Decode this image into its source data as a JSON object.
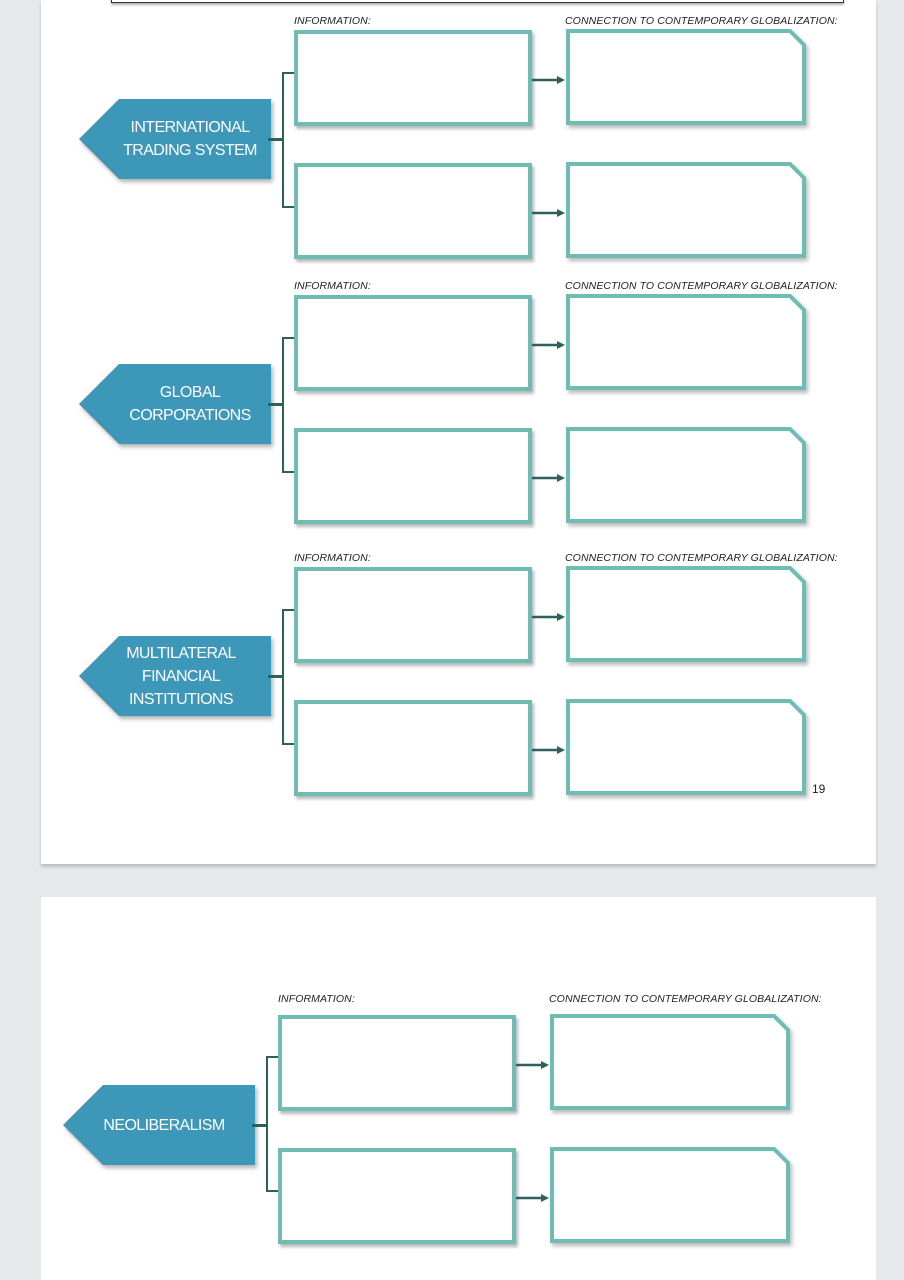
{
  "document": {
    "page_number": "19",
    "accent_colors": {
      "tag_fill": "#3d97b8",
      "box_border": "#6fbcb5",
      "connector": "#2f5f5c",
      "page_background": "#ffffff",
      "viewer_background": "#e6e8ec"
    },
    "column_labels": {
      "information": "INFORMATION:",
      "connection": "CONNECTION TO CONTEMPORARY GLOBALIZATION:"
    },
    "sections": [
      {
        "topic_lines": [
          "INTERNATIONAL",
          "TRADING SYSTEM"
        ],
        "information_boxes": [
          "",
          ""
        ],
        "connection_boxes": [
          "",
          ""
        ]
      },
      {
        "topic_lines": [
          "GLOBAL",
          "CORPORATIONS"
        ],
        "information_boxes": [
          "",
          ""
        ],
        "connection_boxes": [
          "",
          ""
        ]
      },
      {
        "topic_lines": [
          "MULTILATERAL",
          "FINANCIAL",
          "INSTITUTIONS"
        ],
        "information_boxes": [
          "",
          ""
        ],
        "connection_boxes": [
          "",
          ""
        ]
      },
      {
        "topic_lines": [
          "NEOLIBERALISM"
        ],
        "information_boxes": [
          "",
          ""
        ],
        "connection_boxes": [
          "",
          ""
        ]
      }
    ]
  }
}
